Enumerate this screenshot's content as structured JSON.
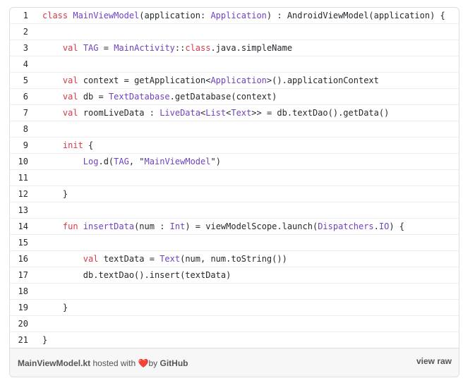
{
  "code": {
    "lines": [
      {
        "n": "1",
        "text": "class MainViewModel(application: Application) : AndroidViewModel(application) {"
      },
      {
        "n": "2",
        "text": ""
      },
      {
        "n": "3",
        "text": "    val TAG = MainActivity::class.java.simpleName"
      },
      {
        "n": "4",
        "text": ""
      },
      {
        "n": "5",
        "text": "    val context = getApplication<Application>().applicationContext"
      },
      {
        "n": "6",
        "text": "    val db = TextDatabase.getDatabase(context)"
      },
      {
        "n": "7",
        "text": "    val roomLiveData : LiveData<List<Text>> = db.textDao().getData()"
      },
      {
        "n": "8",
        "text": ""
      },
      {
        "n": "9",
        "text": "    init {"
      },
      {
        "n": "10",
        "text": "        Log.d(TAG, \"MainViewModel\")"
      },
      {
        "n": "11",
        "text": ""
      },
      {
        "n": "12",
        "text": "    }"
      },
      {
        "n": "13",
        "text": ""
      },
      {
        "n": "14",
        "text": "    fun insertData(num : Int) = viewModelScope.launch(Dispatchers.IO) {"
      },
      {
        "n": "15",
        "text": ""
      },
      {
        "n": "16",
        "text": "        val textData = Text(num, num.toString())"
      },
      {
        "n": "17",
        "text": "        db.textDao().insert(textData)"
      },
      {
        "n": "18",
        "text": ""
      },
      {
        "n": "19",
        "text": "    }"
      },
      {
        "n": "20",
        "text": ""
      },
      {
        "n": "21",
        "text": "}"
      }
    ]
  },
  "footer": {
    "filename": "MainViewModel.kt",
    "hosted_with": " hosted with ",
    "heart_icon": "heart-icon",
    "by": "by ",
    "github": "GitHub",
    "view_raw": "view raw"
  }
}
